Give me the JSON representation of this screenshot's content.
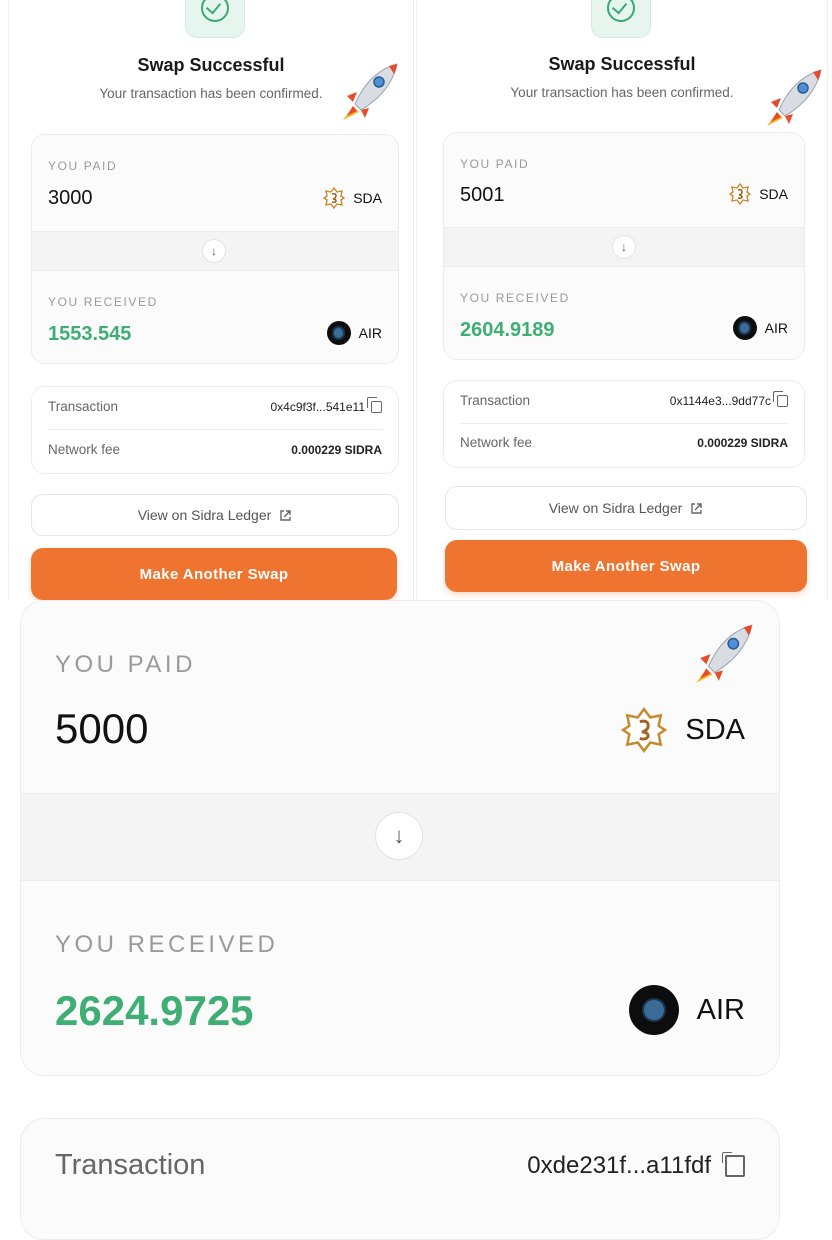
{
  "panels": [
    {
      "title": "Swap Successful",
      "subtitle": "Your transaction has been confirmed.",
      "paid_label": "YOU PAID",
      "paid_amount": "3000",
      "paid_token": "SDA",
      "received_label": "YOU RECEIVED",
      "received_amount": "1553.545",
      "received_token": "AIR",
      "tx_label": "Transaction",
      "tx_hash": "0x4c9f3f...541e11",
      "fee_label": "Network fee",
      "fee_value": "0.000229 SIDRA",
      "ledger_label": "View on Sidra Ledger",
      "cta_label": "Make Another Swap"
    },
    {
      "title": "Swap Successful",
      "subtitle": "Your transaction has been confirmed.",
      "paid_label": "YOU PAID",
      "paid_amount": "5001",
      "paid_token": "SDA",
      "received_label": "YOU RECEIVED",
      "received_amount": "2604.9189",
      "received_token": "AIR",
      "tx_label": "Transaction",
      "tx_hash": "0x1144e3...9dd77c",
      "fee_label": "Network fee",
      "fee_value": "0.000229 SIDRA",
      "ledger_label": "View on Sidra Ledger",
      "cta_label": "Make Another Swap"
    }
  ],
  "zoom": {
    "paid_label": "YOU PAID",
    "paid_amount": "5000",
    "paid_token": "SDA",
    "received_label": "YOU RECEIVED",
    "received_amount": "2624.9725",
    "received_token": "AIR",
    "tx_label": "Transaction",
    "tx_hash": "0xde231f...a11fdf"
  },
  "colors": {
    "accent_orange": "#ef7430",
    "success_green": "#3fae74"
  },
  "icons": [
    "check-circle-icon",
    "rocket-icon",
    "sda-token-icon",
    "air-token-icon",
    "arrow-down-icon",
    "copy-icon",
    "external-link-icon"
  ]
}
